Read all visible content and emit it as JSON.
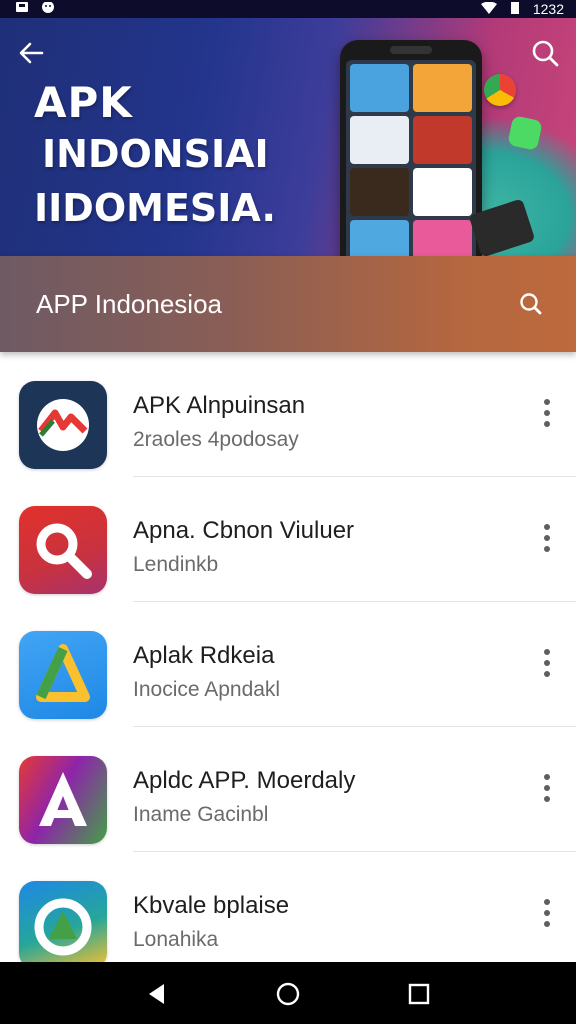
{
  "status_bar": {
    "time": "1232",
    "icons": [
      "notification-icon",
      "notification-icon",
      "wifi-icon",
      "battery-icon"
    ]
  },
  "hero": {
    "line1": "APK",
    "line2": "INDONSIAI",
    "line3": "IIDOMESIA.",
    "icons": [
      "back-arrow-icon",
      "search-icon"
    ]
  },
  "title_bar": {
    "title": "APP Indonesioa",
    "icons": [
      "search-icon"
    ]
  },
  "apps": [
    {
      "name": "APK Alnpuinsan",
      "subtitle": "2raoles 4podosay",
      "icon": "red-arrow-app-icon",
      "colors": [
        "#1d3557",
        "#2b4a7a"
      ]
    },
    {
      "name": "Apna. Cbnon Viuluer",
      "subtitle": "Lendinkb",
      "icon": "magnifier-app-icon",
      "colors": [
        "#e2312b",
        "#a8326e"
      ]
    },
    {
      "name": "Aplak Rdkeia",
      "subtitle": "Inocice Apndakl",
      "icon": "triangle-app-icon",
      "colors": [
        "#1e88e5",
        "#42a5f5"
      ]
    },
    {
      "name": "Apldc APP. Moerdaly",
      "subtitle": "Iname Gacinbl",
      "icon": "letter-a-app-icon",
      "colors": [
        "#e53935",
        "#2e7d32"
      ]
    },
    {
      "name": "Kbvale bplaise",
      "subtitle": "Lonahika",
      "icon": "green-circle-app-icon",
      "colors": [
        "#1e88e5",
        "#43a047"
      ]
    }
  ],
  "nav_bar": {
    "icons": [
      "back-icon",
      "home-icon",
      "recents-icon"
    ]
  },
  "colors": {
    "title_bar_gradient": [
      "#6e5a64",
      "#bd6a3d"
    ],
    "hero_gradient": [
      "#1f2f78",
      "#c9457a"
    ],
    "divider": "#e3e3e3"
  }
}
